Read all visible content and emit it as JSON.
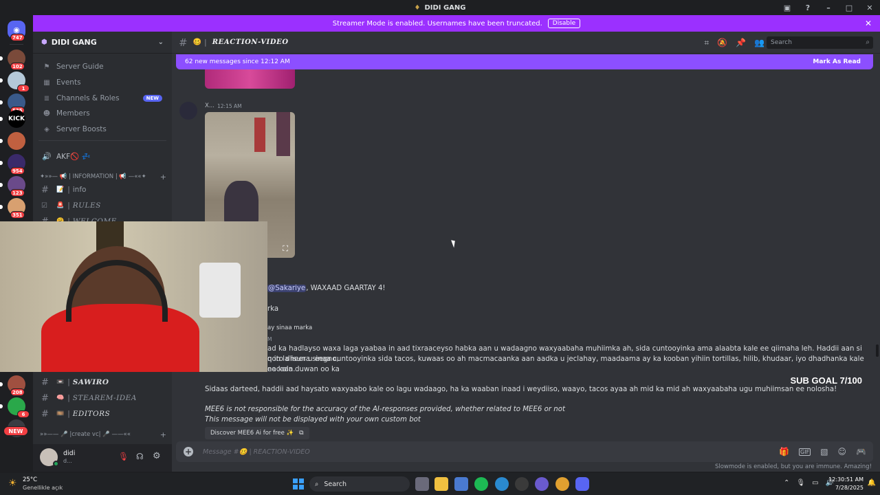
{
  "window": {
    "title": "DIDI GANG"
  },
  "guilds": [
    {
      "badge": "747",
      "color": "#5865f2"
    },
    {
      "badge": "102",
      "color": "#7a4a3a"
    },
    {
      "badge": "1",
      "color": "#b4c8d8"
    },
    {
      "badge": "535",
      "color": "#3a5a8a"
    },
    {
      "badge": "",
      "label": "KICK",
      "color": "#000000"
    },
    {
      "badge": "",
      "color": "#c06040"
    },
    {
      "badge": "954",
      "color": "#3a2a6a"
    },
    {
      "badge": "123",
      "color": "#6a4a8a"
    },
    {
      "badge": "351",
      "color": "#d8a070"
    },
    {
      "badge": "208",
      "color": "#a05040"
    },
    {
      "badge": "6",
      "color": "#2aa84a"
    },
    {
      "badge": "NEW",
      "color": "#3a3c42"
    }
  ],
  "streamer_banner": {
    "text": "Streamer Mode is enabled. Usernames have been truncated.",
    "button": "Disable"
  },
  "server": {
    "name": "DIDI GANG",
    "nav": [
      {
        "label": "Server Guide",
        "icon": "signpost-icon"
      },
      {
        "label": "Events",
        "icon": "calendar-icon"
      },
      {
        "label": "Channels & Roles",
        "icon": "list-icon",
        "badge": "NEW"
      },
      {
        "label": "Members",
        "icon": "members-icon"
      },
      {
        "label": "Server Boosts",
        "icon": "boost-icon"
      }
    ],
    "voice_channel": "AKF🚫 💤",
    "category_info": "✦»»— 📢 | INFORMATION | 📢 —««✦",
    "channels_top": [
      {
        "emoji": "📝",
        "label": "info"
      },
      {
        "emoji": "🚨",
        "label": "RULES"
      },
      {
        "emoji": "🤗",
        "label": "WELCOME"
      }
    ],
    "channels_bottom": [
      {
        "emoji": "📼",
        "label": "SAWIRO"
      },
      {
        "emoji": "🧠",
        "label": "STEAREM-IDEA"
      },
      {
        "emoji": "🎞️",
        "label": "EDITORS"
      }
    ],
    "category_create": "»»—— 🎤 |create vc| 🎤 ——««"
  },
  "user": {
    "name": "didi",
    "status": "d..."
  },
  "channel": {
    "emoji": "🥴",
    "name": "REACTION-VIDEO",
    "search_placeholder": "Search"
  },
  "new_messages": {
    "text": "62 new messages since 12:12 AM",
    "action": "Mark As Read"
  },
  "messages": {
    "author": "X...",
    "time": "12:15 AM",
    "mention": "@Sakariye",
    "mention_rest": ", WAXAAD GAARTAY  4!",
    "frag1": "rka",
    "frag2": "ay sinaa marka",
    "frag3": "M",
    "para1_l1": "ad ka hadlayso waxa laga yaabaa in aad tixraaceyso habka aan u wadaagno waxyaabaha muhiimka ah, sida cuntooyinka ama alaabta kale ee qiimaha leh. Haddii aan si qoto dheer u eegno,",
    "para1_l2": "n in la isuna sinaa cuntooyinka sida tacos, kuwaas oo ah macmacaanka aan aadka u jeclahay, maadaama ay ka kooban yihiin tortillas, hilib, khudaar, iyo dhadhanka kale ee kala duwan oo ka",
    "para1_l3": "nacaan.",
    "para2": "Sidaas darteed, haddii aad haysato waxyaabo kale oo lagu wadaago, ha ka waaban inaad i weydiiso, waayo, tacos ayaa ah mid ka mid ah waxyaabaha ugu muhiimsan ee nolosha!",
    "disclaimer1": "MEE6 is not responsible for the accuracy of the AI-responses provided, whether related to MEE6 or not",
    "disclaimer2": "This message will not be displayed with your own custom bot",
    "discover_btn": "Discover MEE6 Ai for free ✨"
  },
  "sub_goal": "SUB GOAL 7/100",
  "composer": {
    "placeholder": "Message #🥴 | REACTION-VIDEO"
  },
  "slowmode": "Slowmode is enabled, but you are immune. Amazing!",
  "taskbar": {
    "weather_temp": "25°C",
    "weather_desc": "Genellikle açık",
    "search": "Search",
    "time": "12:30:51 AM",
    "date": "7/28/2025"
  }
}
